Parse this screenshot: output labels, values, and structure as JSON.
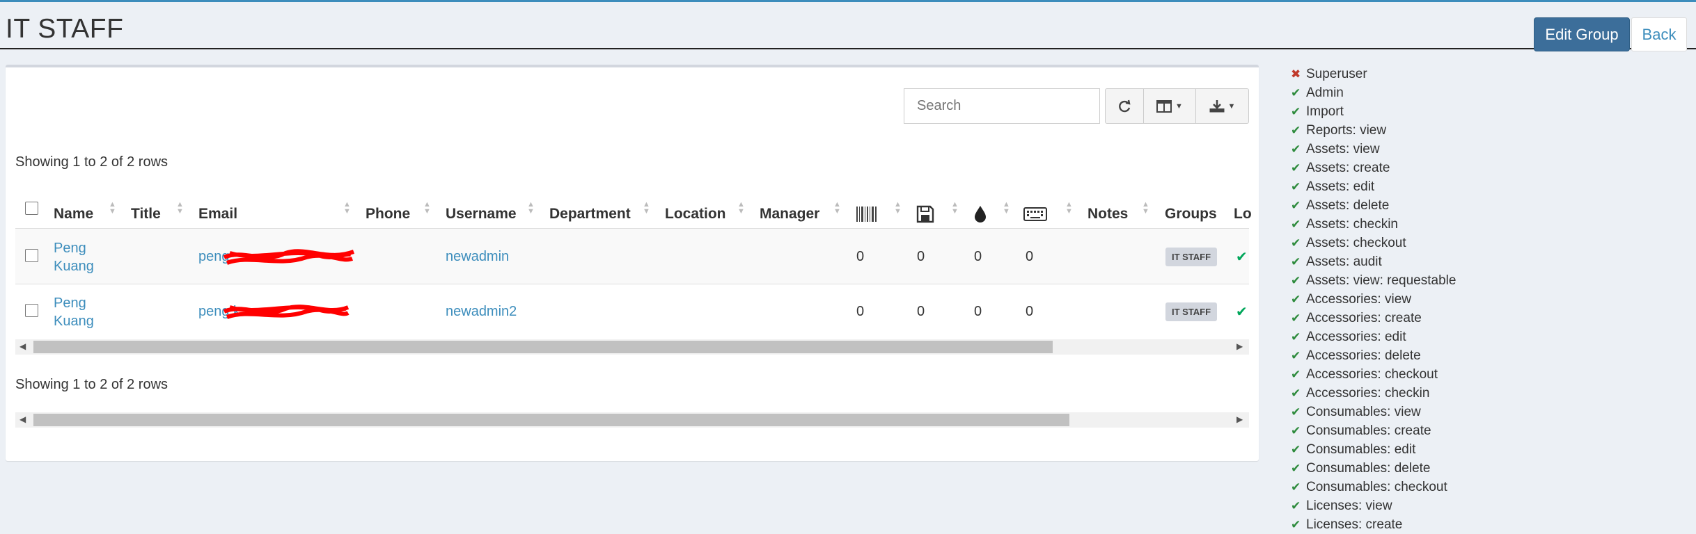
{
  "page": {
    "title": "IT STAFF"
  },
  "header": {
    "edit_label": "Edit Group",
    "back_label": "Back"
  },
  "toolbar": {
    "search_placeholder": "Search",
    "refresh_icon": "refresh-icon",
    "columns_icon": "columns-icon",
    "export_icon": "download-icon"
  },
  "table": {
    "showing_top": "Showing 1 to 2 of 2 rows",
    "showing_bottom": "Showing 1 to 2 of 2 rows",
    "columns": {
      "name": "Name",
      "title": "Title",
      "email": "Email",
      "phone": "Phone",
      "username": "Username",
      "department": "Department",
      "location": "Location",
      "manager": "Manager",
      "notes": "Notes",
      "groups": "Groups",
      "lo": "Lo"
    },
    "icon_columns": [
      "barcode-icon",
      "save-icon",
      "drop-icon",
      "keyboard-icon"
    ],
    "rows": [
      {
        "name_first": "Peng",
        "name_last": "Kuang",
        "email": "peng",
        "username": "newadmin",
        "c1": "0",
        "c2": "0",
        "c3": "0",
        "c4": "0",
        "group": "IT STAFF"
      },
      {
        "name_first": "Peng",
        "name_last": "Kuang",
        "email": "peng.k",
        "username": "newadmin2",
        "c1": "0",
        "c2": "0",
        "c3": "0",
        "c4": "0",
        "group": "IT STAFF"
      }
    ]
  },
  "permissions": [
    {
      "label": "Superuser",
      "granted": false
    },
    {
      "label": "Admin",
      "granted": true
    },
    {
      "label": "Import",
      "granted": true
    },
    {
      "label": "Reports: view",
      "granted": true
    },
    {
      "label": "Assets: view",
      "granted": true
    },
    {
      "label": "Assets: create",
      "granted": true
    },
    {
      "label": "Assets: edit",
      "granted": true
    },
    {
      "label": "Assets: delete",
      "granted": true
    },
    {
      "label": "Assets: checkin",
      "granted": true
    },
    {
      "label": "Assets: checkout",
      "granted": true
    },
    {
      "label": "Assets: audit",
      "granted": true
    },
    {
      "label": "Assets: view: requestable",
      "granted": true
    },
    {
      "label": "Accessories: view",
      "granted": true
    },
    {
      "label": "Accessories: create",
      "granted": true
    },
    {
      "label": "Accessories: edit",
      "granted": true
    },
    {
      "label": "Accessories: delete",
      "granted": true
    },
    {
      "label": "Accessories: checkout",
      "granted": true
    },
    {
      "label": "Accessories: checkin",
      "granted": true
    },
    {
      "label": "Consumables: view",
      "granted": true
    },
    {
      "label": "Consumables: create",
      "granted": true
    },
    {
      "label": "Consumables: edit",
      "granted": true
    },
    {
      "label": "Consumables: delete",
      "granted": true
    },
    {
      "label": "Consumables: checkout",
      "granted": true
    },
    {
      "label": "Licenses: view",
      "granted": true
    },
    {
      "label": "Licenses: create",
      "granted": true
    }
  ],
  "colors": {
    "accent": "#3c8dbc",
    "edit_button": "#3c6e9a",
    "check": "#2e8b3d",
    "cross": "#c0392b"
  }
}
